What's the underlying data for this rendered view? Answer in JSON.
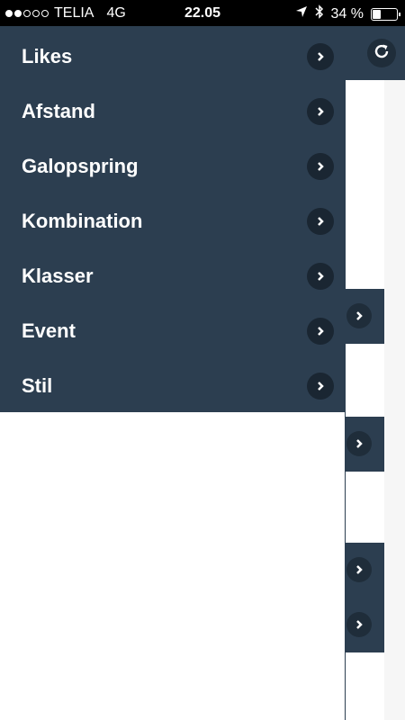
{
  "status_bar": {
    "signal_dots": [
      true,
      true,
      false,
      false,
      false
    ],
    "carrier": "TELIA",
    "network": "4G",
    "time": "22.05",
    "battery_text": "34 %",
    "battery_level": 0.34
  },
  "drawer": {
    "items": [
      {
        "label": "Likes"
      },
      {
        "label": "Afstand"
      },
      {
        "label": "Galopspring"
      },
      {
        "label": "Kombination"
      },
      {
        "label": "Klasser"
      },
      {
        "label": "Event"
      },
      {
        "label": "Stil"
      }
    ]
  },
  "colors": {
    "nav_background": "#2c3e50",
    "chevron_background": "#1a2632",
    "text": "#ffffff"
  },
  "icons": {
    "refresh": "refresh-icon",
    "chevron": "chevron-right-icon",
    "location": "location-arrow-icon",
    "bluetooth": "bluetooth-icon",
    "battery": "battery-icon"
  }
}
